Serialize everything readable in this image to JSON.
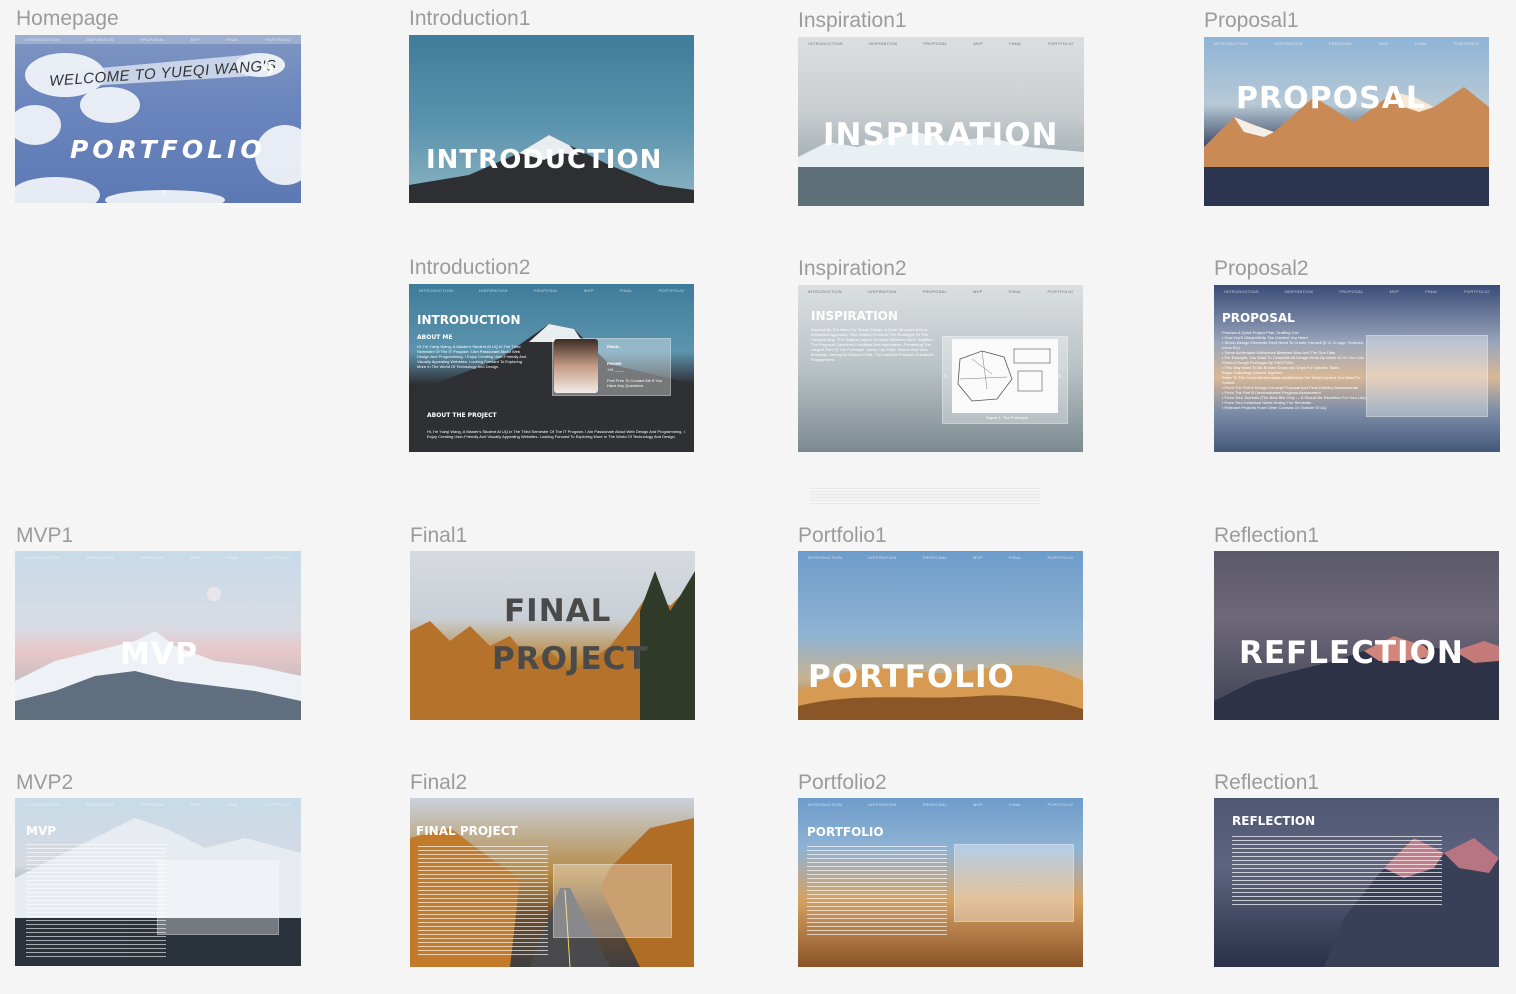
{
  "frames": {
    "homepage": {
      "label": "Homepage",
      "nav": [
        "INTRODUCTION",
        "INSPIRATION",
        "PROPOSAL",
        "MVP",
        "FINAL",
        "PORTFOLIO"
      ],
      "banner": "WELCOME TO YUEQI WANG'S",
      "title": "PORTFOLIO"
    },
    "introduction1": {
      "label": "Introduction1",
      "title": "INTRODUCTION"
    },
    "inspiration1": {
      "label": "Inspiration1",
      "title": "INSPIRATION"
    },
    "proposal1": {
      "label": "Proposal1",
      "title": "PROPOSAL"
    },
    "introduction2": {
      "label": "Introduction2",
      "title": "INTRODUCTION",
      "about_me": "ABOUT ME",
      "about_me_text": "Hi, I'm Yueqi Wang, A Master's Student At UQ In The Third Semester Of The IT Program. I Am Passionate About Web Design And Programming. I Enjoy Creating User-Friendly And Visually Appealing Websites. Looking Forward To Exploring More In The World Of Technology And Design.",
      "email_label": "EMAIL:",
      "phone_label": "PHONE:",
      "phone_value": "+61 ____",
      "contact_note": "Feel Free To Contact Me If You Have Any Questions",
      "about_project": "ABOUT THE PROJECT",
      "about_project_text": "Hi, I'm Yueqi Wang, A Master's Student At UQ In The Third Semester Of The IT Program. I Am Passionate About Web Design And Programming. I Enjoy Creating User-Friendly And Visually Appealing Websites. Looking Forward To Exploring More In The World Of Technology And Design."
    },
    "inspiration2": {
      "label": "Inspiration2",
      "title": "INSPIRATION",
      "caption": "Figure 1. The Prototype",
      "text": "Inspired By The Need For Visual Design, A Clear Structure And An Interactive Approach, This Section Presents The Prototype Of The Campus Map. The Original Layout Grouped Different Users Together. The Proposal Combines Functions And Information, Presenting The Largest Part Of The Prototype. Users Can Filter, Search And View Buildings. Among All Marked Parts, The Interface Provides Enhanced Engagement."
    },
    "proposal2": {
      "label": "Proposal2",
      "title": "PROPOSAL",
      "text": "Produce A Quick Project Plan, Drafting Out:\n• How You'll Obtain/Write The Content You Need\n• Which Design Elements You'll Need To Create Yourself (E.G. A Logo, Textures, Icons Etc)\n• Some Achievable Milestones Between Now And The Due Date\n  • For Example, You Want To Complete All Design Work By Week 10 So You Can Finish A Rough Prototype By SWOTVAC\n  • This May Need To Be Broken Down Into Days For Specific Tasks\nBegin Collecting Content Together\nRefer To The Content/Information Architecture For What Content You Need To Collect:\n• From The Part A Design Concept Proposal And Final Delivery Assessments\n• From The Part B Demonstrative Progress Assessment\n• From Your Journals (The Best Bits Only — It Should Be Rewritten For Your Use)\n• From Your Individual Notes During The Semester\n• Relevant Projects From Other Courses Or Outside Of UQ"
    },
    "mvp1": {
      "label": "MVP1",
      "title": "MVP"
    },
    "final1": {
      "label": "Final1",
      "title_line1": "FINAL",
      "title_line2": "PROJECT"
    },
    "portfolio1": {
      "label": "Portfolio1",
      "title": "PORTFOLIO"
    },
    "reflection1": {
      "label": "Reflection1",
      "title": "REFLECTION"
    },
    "mvp2": {
      "label": "MVP2",
      "title": "MVP"
    },
    "final2": {
      "label": "Final2",
      "title": "FINAL PROJECT"
    },
    "portfolio2": {
      "label": "Portfolio2",
      "title": "PORTFOLIO"
    },
    "reflection2": {
      "label": "Reflection1",
      "title": "REFLECTION"
    }
  }
}
